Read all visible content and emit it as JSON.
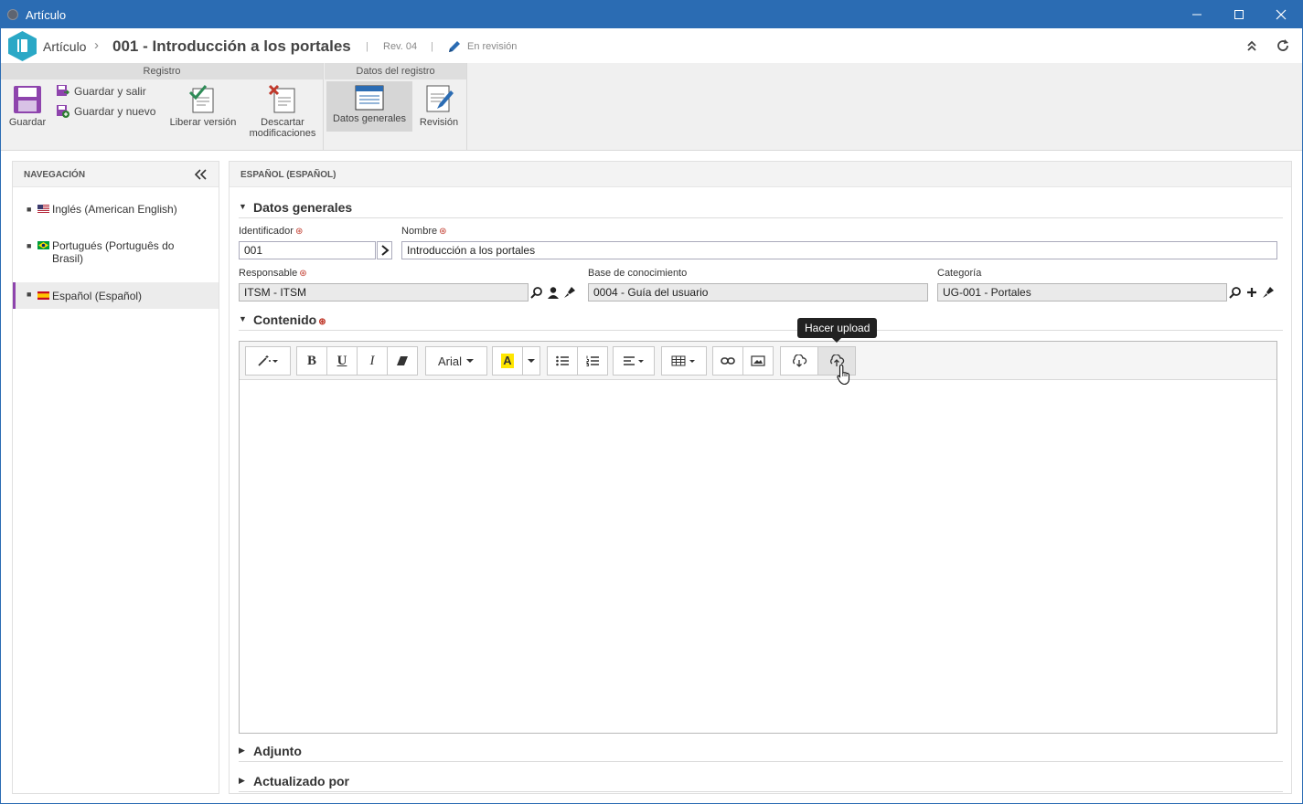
{
  "window": {
    "title": "Artículo"
  },
  "header": {
    "breadcrumb_root": "Artículo",
    "breadcrumb_sep": "›",
    "record_title": "001 - Introducción a los portales",
    "revision": "Rev. 04",
    "status": "En revisión"
  },
  "ribbon": {
    "group_registro": "Registro",
    "group_datos": "Datos del registro",
    "guardar": "Guardar",
    "guardar_salir": "Guardar y salir",
    "guardar_nuevo": "Guardar y nuevo",
    "liberar": "Liberar versión",
    "descartar_1": "Descartar",
    "descartar_2": "modificaciones",
    "datos_generales": "Datos generales",
    "revision": "Revisión"
  },
  "nav": {
    "title": "NAVEGACIÓN",
    "items": [
      {
        "label": "Inglés (American English)"
      },
      {
        "label": "Portugués (Português do Brasil)"
      },
      {
        "label": "Español (Español)"
      }
    ]
  },
  "main": {
    "title": "ESPAÑOL (ESPAÑOL)",
    "section_general": "Datos generales",
    "identificador_label": "Identificador",
    "identificador_value": "001",
    "nombre_label": "Nombre",
    "nombre_value": "Introducción a los portales",
    "responsable_label": "Responsable",
    "responsable_value": "ITSM - ITSM",
    "base_label": "Base de conocimiento",
    "base_value": "0004 - Guía del usuario",
    "categoria_label": "Categoría",
    "categoria_value": "UG-001 - Portales",
    "section_contenido": "Contenido",
    "font_name": "Arial",
    "tooltip": "Hacer upload",
    "section_adjunto": "Adjunto",
    "section_actualizado": "Actualizado por"
  },
  "colors": {
    "titlebar": "#2b6cb3",
    "accent": "#2aa8c6",
    "nav_active": "#8e44ad"
  }
}
